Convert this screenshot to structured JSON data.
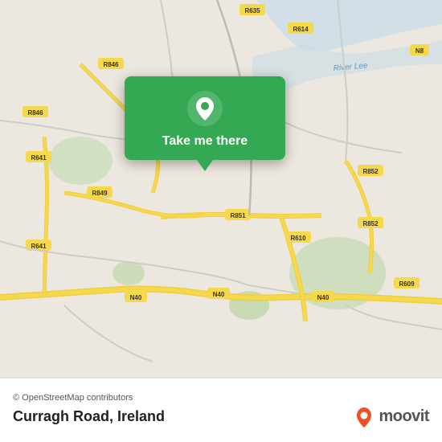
{
  "map": {
    "background_color": "#e8e0d8",
    "center_lat": 51.87,
    "center_lng": -8.47
  },
  "popup": {
    "label": "Take me there",
    "pin_icon": "location-pin"
  },
  "bottom_bar": {
    "attribution": "© OpenStreetMap contributors",
    "location_name": "Curragh Road, Ireland",
    "logo_text": "moovit"
  }
}
